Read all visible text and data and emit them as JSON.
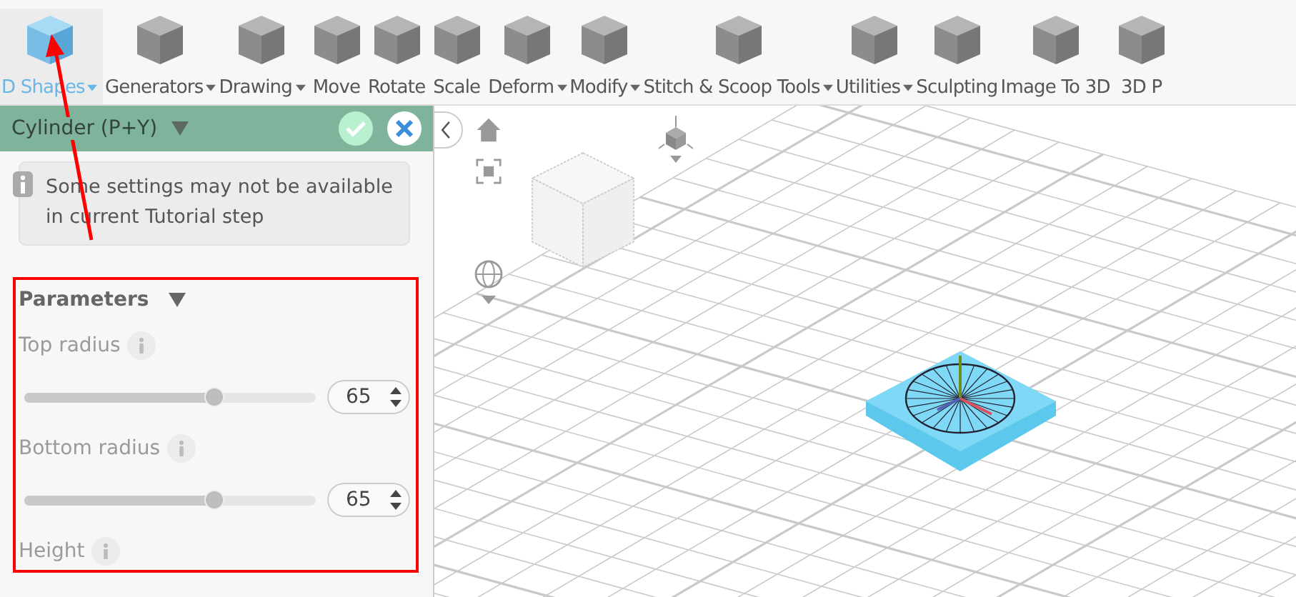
{
  "toolbar": {
    "items": [
      {
        "label": "D Shapes",
        "dropdown": true,
        "selected": true
      },
      {
        "label": "Generators",
        "dropdown": true,
        "selected": false
      },
      {
        "label": "Drawing",
        "dropdown": true,
        "selected": false
      },
      {
        "label": "Move",
        "dropdown": false,
        "selected": false
      },
      {
        "label": "Rotate",
        "dropdown": false,
        "selected": false
      },
      {
        "label": "Scale",
        "dropdown": false,
        "selected": false
      },
      {
        "label": "Deform",
        "dropdown": true,
        "selected": false
      },
      {
        "label": "Modify",
        "dropdown": true,
        "selected": false
      },
      {
        "label": "Stitch & Scoop Tools",
        "dropdown": true,
        "selected": false
      },
      {
        "label": "Utilities",
        "dropdown": true,
        "selected": false
      },
      {
        "label": "Sculpting",
        "dropdown": false,
        "selected": false
      },
      {
        "label": "Image To 3D",
        "dropdown": false,
        "selected": false
      },
      {
        "label": "3D P",
        "dropdown": false,
        "selected": false
      }
    ]
  },
  "panel": {
    "title": "Cylinder (P+Y)",
    "notice": "Some settings may not be available in current Tutorial step",
    "section": {
      "title": "Parameters",
      "expanded": true,
      "params": [
        {
          "label": "Top radius",
          "level": 0.65,
          "value": "65"
        },
        {
          "label": "Bottom radius",
          "level": 0.65,
          "value": "65"
        },
        {
          "label": "Height"
        }
      ]
    }
  }
}
